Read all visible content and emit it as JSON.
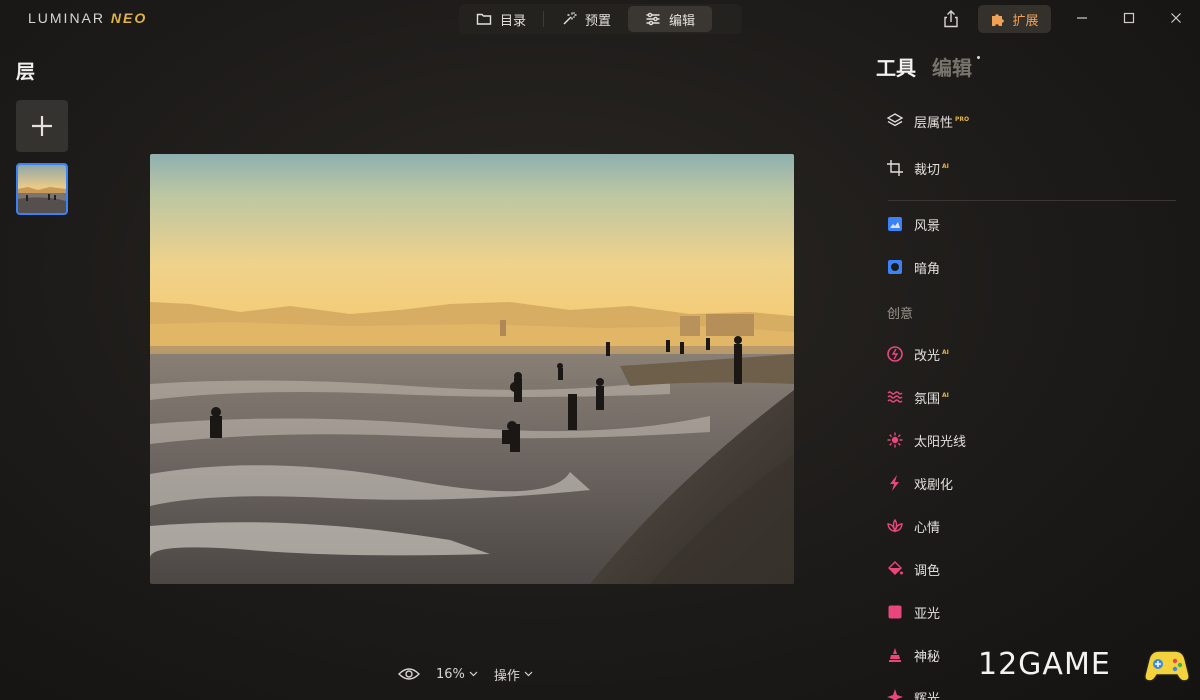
{
  "app": {
    "logo_main": "LUMINAR",
    "logo_neo": "NEO"
  },
  "modes": [
    {
      "label": "目录",
      "icon": "folder-icon"
    },
    {
      "label": "预置",
      "icon": "magic-wand-icon"
    },
    {
      "label": "编辑",
      "icon": "sliders-icon",
      "active": true
    }
  ],
  "header": {
    "extensions_label": "扩展"
  },
  "layers": {
    "title": "层"
  },
  "bottom": {
    "zoom": "16%",
    "actions_label": "操作"
  },
  "tools": {
    "tab_tools": "工具",
    "tab_edits": "编辑",
    "essentials": [
      {
        "label": "层属性",
        "badge": "PRO"
      },
      {
        "label": "裁切",
        "badge": "AI"
      }
    ],
    "main": [
      {
        "label": "风景",
        "badge": ""
      },
      {
        "label": "暗角",
        "badge": ""
      }
    ],
    "creative_label": "创意",
    "creative": [
      {
        "label": "改光",
        "badge": "AI"
      },
      {
        "label": "氛围",
        "badge": "AI"
      },
      {
        "label": "太阳光线",
        "badge": ""
      },
      {
        "label": "戏剧化",
        "badge": ""
      },
      {
        "label": "心情",
        "badge": ""
      },
      {
        "label": "调色",
        "badge": ""
      },
      {
        "label": "亚光",
        "badge": ""
      },
      {
        "label": "神秘",
        "badge": ""
      },
      {
        "label": "辉光",
        "badge": ""
      }
    ]
  },
  "watermark": {
    "text": "12GAME"
  },
  "colors": {
    "accent_blue": "#3b82f6",
    "accent_pink": "#e8467e",
    "pro_gold": "#e2b347",
    "ext_orange": "#f0a155"
  }
}
